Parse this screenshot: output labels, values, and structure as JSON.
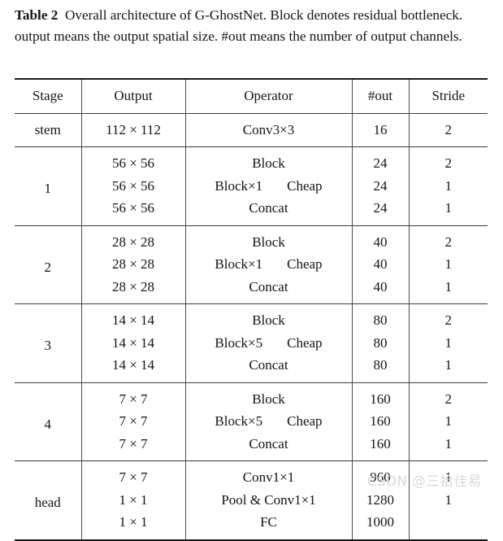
{
  "caption": {
    "label": "Table 2",
    "text": "Overall architecture of G-GhostNet. Block denotes residual bottleneck. output means the output spatial size. #out means the number of output channels."
  },
  "table": {
    "headers": [
      "Stage",
      "Output",
      "Operator",
      "#out",
      "Stride"
    ],
    "groups": [
      {
        "stage": "stem",
        "rows": [
          {
            "output": "112 × 112",
            "operator": "Conv3×3",
            "operator_left": "",
            "operator_right": "",
            "nout": "16",
            "stride": "2"
          }
        ]
      },
      {
        "stage": "1",
        "rows": [
          {
            "output": "56 × 56",
            "operator": "Block",
            "operator_left": "",
            "operator_right": "",
            "nout": "24",
            "stride": "2"
          },
          {
            "output": "56 × 56",
            "operator": "",
            "operator_left": "Block×1",
            "operator_right": "Cheap",
            "nout": "24",
            "stride": "1"
          },
          {
            "output": "56 × 56",
            "operator": "Concat",
            "operator_left": "",
            "operator_right": "",
            "nout": "24",
            "stride": "1"
          }
        ]
      },
      {
        "stage": "2",
        "rows": [
          {
            "output": "28 × 28",
            "operator": "Block",
            "operator_left": "",
            "operator_right": "",
            "nout": "40",
            "stride": "2"
          },
          {
            "output": "28 × 28",
            "operator": "",
            "operator_left": "Block×1",
            "operator_right": "Cheap",
            "nout": "40",
            "stride": "1"
          },
          {
            "output": "28 × 28",
            "operator": "Concat",
            "operator_left": "",
            "operator_right": "",
            "nout": "40",
            "stride": "1"
          }
        ]
      },
      {
        "stage": "3",
        "rows": [
          {
            "output": "14 × 14",
            "operator": "Block",
            "operator_left": "",
            "operator_right": "",
            "nout": "80",
            "stride": "2"
          },
          {
            "output": "14 × 14",
            "operator": "",
            "operator_left": "Block×5",
            "operator_right": "Cheap",
            "nout": "80",
            "stride": "1"
          },
          {
            "output": "14 × 14",
            "operator": "Concat",
            "operator_left": "",
            "operator_right": "",
            "nout": "80",
            "stride": "1"
          }
        ]
      },
      {
        "stage": "4",
        "rows": [
          {
            "output": "7 × 7",
            "operator": "Block",
            "operator_left": "",
            "operator_right": "",
            "nout": "160",
            "stride": "2"
          },
          {
            "output": "7 × 7",
            "operator": "",
            "operator_left": "Block×5",
            "operator_right": "Cheap",
            "nout": "160",
            "stride": "1"
          },
          {
            "output": "7 × 7",
            "operator": "Concat",
            "operator_left": "",
            "operator_right": "",
            "nout": "160",
            "stride": "1"
          }
        ]
      },
      {
        "stage": "head",
        "rows": [
          {
            "output": "7 × 7",
            "operator": "Conv1×1",
            "operator_left": "",
            "operator_right": "",
            "nout": "960",
            "stride": "1"
          },
          {
            "output": "1 × 1",
            "operator": "Pool & Conv1×1",
            "operator_left": "",
            "operator_right": "",
            "nout": "1280",
            "stride": "1"
          },
          {
            "output": "1 × 1",
            "operator": "FC",
            "operator_left": "",
            "operator_right": "",
            "nout": "1000",
            "stride": ""
          }
        ]
      }
    ]
  },
  "watermark": {
    "text": "CSDN @三拾佳易"
  }
}
